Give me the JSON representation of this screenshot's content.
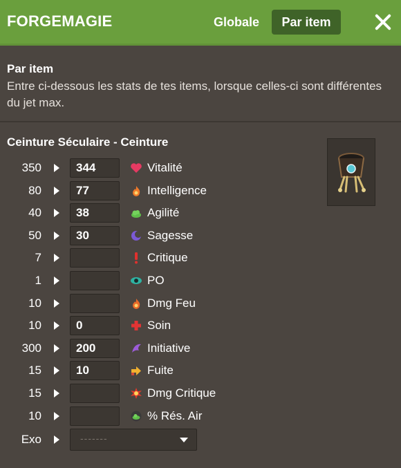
{
  "header": {
    "title": "FORGEMAGIE",
    "mode_global": "Globale",
    "mode_item": "Par item",
    "close_icon": "close-icon"
  },
  "intro": {
    "heading": "Par item",
    "text": "Entre ci-dessous les stats de tes items, lorsque celles-ci sont différentes du jet max."
  },
  "item": {
    "title": "Ceinture Séculaire - Ceinture",
    "image_icon": "belt-item-image"
  },
  "stats": [
    {
      "max": "350",
      "value": "344",
      "label": "Vitalité",
      "icon": "heart-icon"
    },
    {
      "max": "80",
      "value": "77",
      "label": "Intelligence",
      "icon": "fire-icon"
    },
    {
      "max": "40",
      "value": "38",
      "label": "Agilité",
      "icon": "cloud-icon"
    },
    {
      "max": "50",
      "value": "30",
      "label": "Sagesse",
      "icon": "moon-icon"
    },
    {
      "max": "7",
      "value": "",
      "label": "Critique",
      "icon": "exclamation-icon"
    },
    {
      "max": "1",
      "value": "",
      "label": "PO",
      "icon": "eye-icon"
    },
    {
      "max": "10",
      "value": "",
      "label": "Dmg Feu",
      "icon": "fire-damage-icon"
    },
    {
      "max": "10",
      "value": "0",
      "label": "Soin",
      "icon": "cross-icon"
    },
    {
      "max": "300",
      "value": "200",
      "label": "Initiative",
      "icon": "wing-icon"
    },
    {
      "max": "15",
      "value": "10",
      "label": "Fuite",
      "icon": "escape-arrow-icon"
    },
    {
      "max": "15",
      "value": "",
      "label": "Dmg Critique",
      "icon": "burst-icon"
    },
    {
      "max": "10",
      "value": "",
      "label": "% Rés. Air",
      "icon": "air-resist-icon"
    }
  ],
  "exo": {
    "label": "Exo",
    "selected": "-------"
  }
}
